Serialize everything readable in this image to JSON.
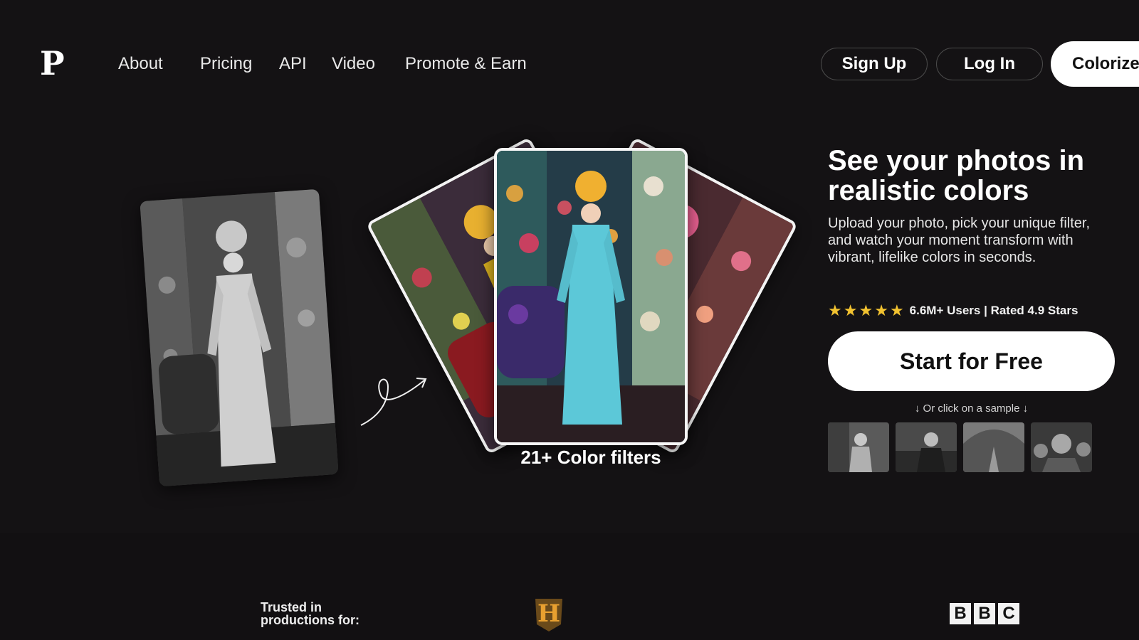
{
  "nav": {
    "logo": "P",
    "links": [
      "About",
      "Pricing",
      "API",
      "Video",
      "Promote & Earn"
    ],
    "signup": "Sign Up",
    "login": "Log In",
    "colorize": "Colorize"
  },
  "hero": {
    "filters_label": "21+ Color filters",
    "title": "See your photos in realistic colors",
    "description": "Upload your photo, pick your unique filter, and watch your moment transform with vibrant, lifelike colors in seconds.",
    "stars": 5,
    "rating_text": "6.6M+ Users | Rated 4.9 Stars",
    "cta": "Start for Free",
    "sample_hint": "↓ Or click on a sample ↓",
    "samples": [
      "sample-photo-1",
      "sample-photo-2",
      "sample-photo-3",
      "sample-photo-4"
    ]
  },
  "trusted": {
    "label": "Trusted in\nproductions for:",
    "history_letter": "H",
    "bbc": [
      "B",
      "B",
      "C"
    ]
  },
  "colors": {
    "background": "#141214",
    "accent_star": "#f2c230",
    "cta_bg": "#ffffff"
  }
}
